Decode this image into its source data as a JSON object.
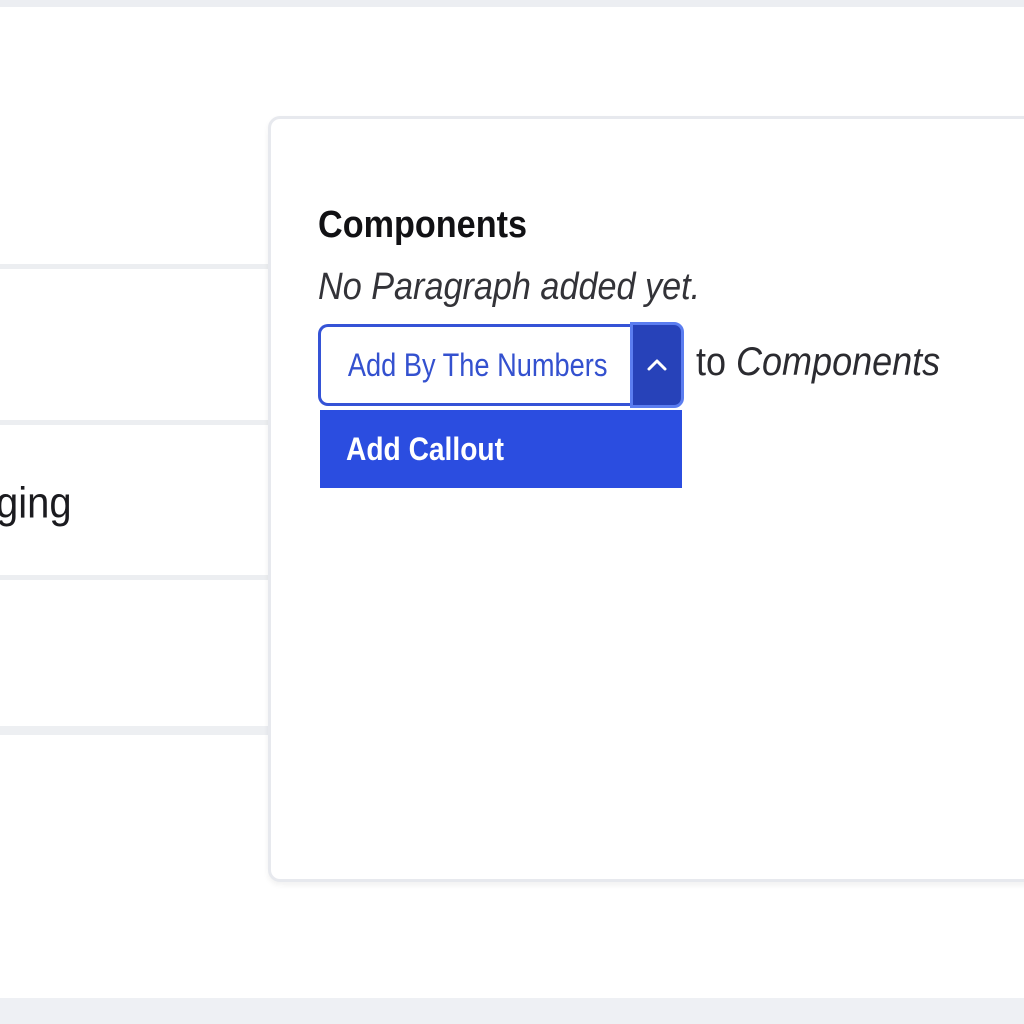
{
  "left_panel": {
    "rows": [
      {
        "label": ""
      },
      {
        "label": "ging"
      },
      {
        "label": ""
      }
    ]
  },
  "components": {
    "title": "Components",
    "empty_message": "No Paragraph added yet.",
    "add_button_label": "Add By The Numbers",
    "suffix_prefix": "to",
    "suffix_target": "Components",
    "dropdown_items": [
      {
        "label": "Add Callout"
      }
    ]
  },
  "colors": {
    "accent": "#2b4de0",
    "accent_dark": "#2742b9",
    "link": "#3451cf"
  },
  "icons": {
    "toggle": "chevron-up-icon"
  }
}
